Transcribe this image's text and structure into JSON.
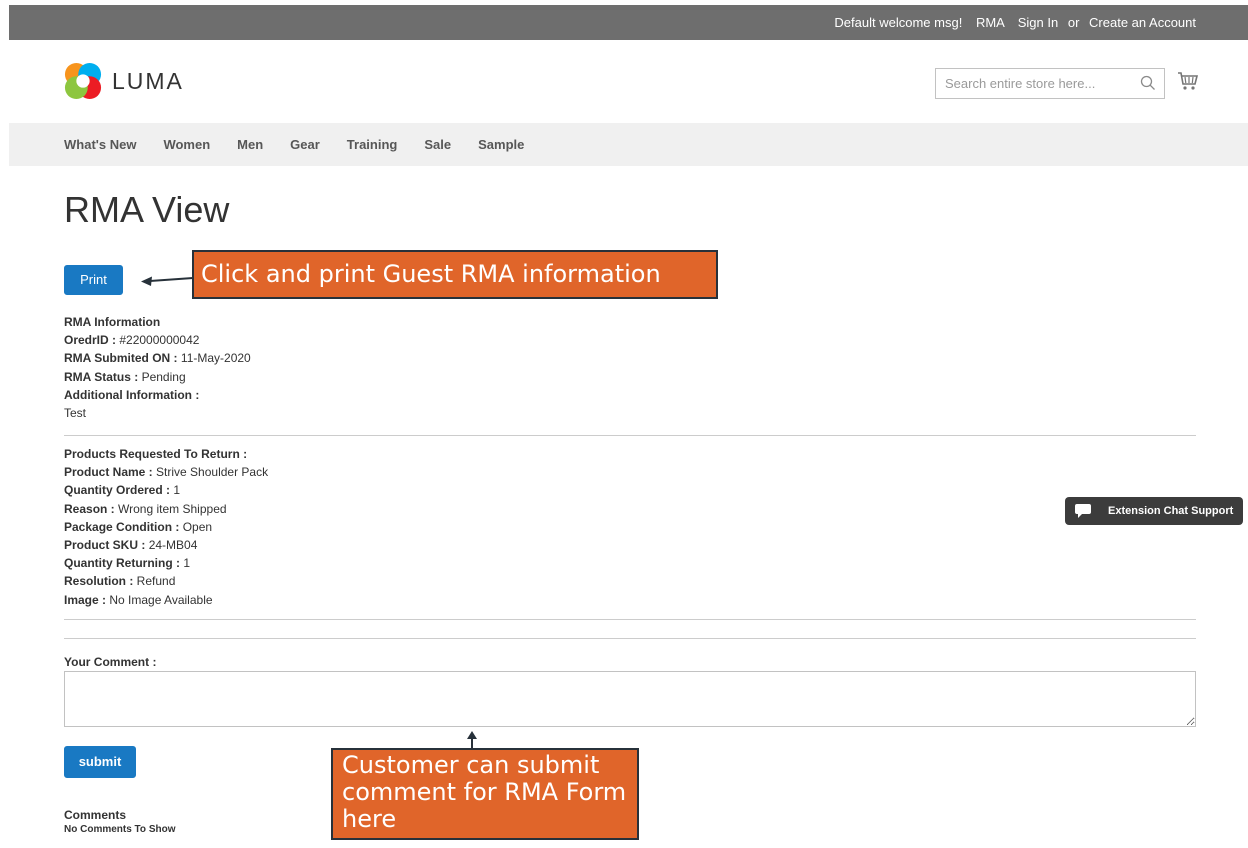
{
  "topbar": {
    "welcome": "Default welcome msg!",
    "rma_link": "RMA",
    "sign_in": "Sign In",
    "or": "or",
    "create_account": "Create an Account"
  },
  "header": {
    "logo_text": "LUMA",
    "search_placeholder": "Search entire store here...",
    "icons": [
      "search-icon",
      "cart-icon"
    ]
  },
  "nav": {
    "items": [
      "What's New",
      "Women",
      "Men",
      "Gear",
      "Training",
      "Sale",
      "Sample"
    ]
  },
  "main": {
    "title": "RMA View",
    "print_label": "Print",
    "rma_info": {
      "heading": "RMA Information",
      "order_id_label": "OredrID :",
      "order_id": "#22000000042",
      "submitted_label": "RMA Submited ON :",
      "submitted": "11-May-2020",
      "status_label": "RMA Status :",
      "status": "Pending",
      "additional_label": "Additional Information :",
      "additional": "Test"
    },
    "products": {
      "heading": "Products Requested To Return :",
      "fields": [
        {
          "label": "Product Name :",
          "value": "Strive Shoulder Pack"
        },
        {
          "label": "Quantity Ordered :",
          "value": "1"
        },
        {
          "label": "Reason :",
          "value": "Wrong item Shipped"
        },
        {
          "label": "Package Condition :",
          "value": "Open"
        },
        {
          "label": "Product SKU :",
          "value": "24-MB04"
        },
        {
          "label": "Quantity Returning :",
          "value": "1"
        },
        {
          "label": "Resolution :",
          "value": "Refund"
        },
        {
          "label": "Image :",
          "value": "No Image Available"
        }
      ]
    },
    "comment_label": "Your Comment :",
    "submit_label": "submit",
    "comments_title": "Comments",
    "no_comments": "No Comments To Show"
  },
  "annotations": {
    "print_callout": "Click and print Guest RMA information",
    "comment_callout": "Customer can submit comment for RMA Form here"
  },
  "chat_widget": {
    "label": "Extension Chat Support"
  },
  "colors": {
    "topbar": "#6e6e6e",
    "nav_bg": "#f0f0f0",
    "button": "#1979c3",
    "callout": "#e0652a",
    "callout_border": "#27313a",
    "chat_bg": "#3c3c3c"
  }
}
